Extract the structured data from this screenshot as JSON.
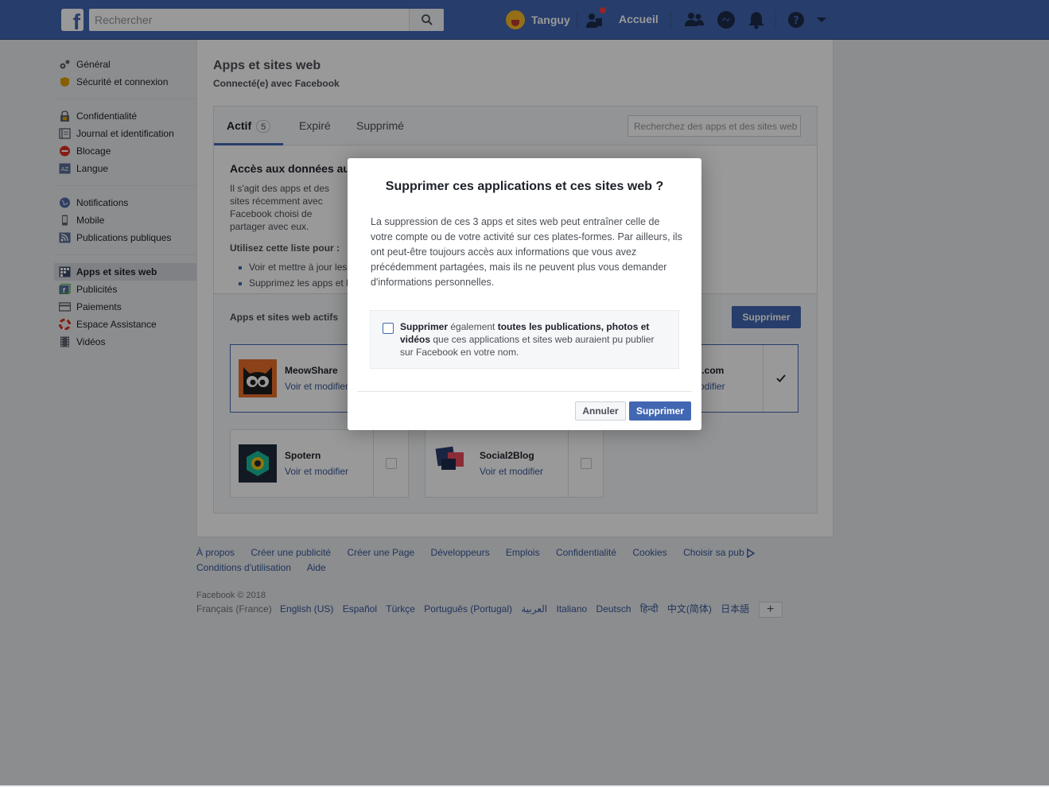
{
  "topbar": {
    "search_placeholder": "Rechercher",
    "user_name": "Tanguy",
    "home_label": "Accueil"
  },
  "sidebar": {
    "groups": [
      [
        {
          "label": "Général",
          "icon": "gears-icon"
        },
        {
          "label": "Sécurité et connexion",
          "icon": "badge-icon"
        }
      ],
      [
        {
          "label": "Confidentialité",
          "icon": "lock-icon"
        },
        {
          "label": "Journal et identification",
          "icon": "timeline-icon"
        },
        {
          "label": "Blocage",
          "icon": "block-icon"
        },
        {
          "label": "Langue",
          "icon": "language-icon"
        }
      ],
      [
        {
          "label": "Notifications",
          "icon": "globe-icon"
        },
        {
          "label": "Mobile",
          "icon": "phone-icon"
        },
        {
          "label": "Publications publiques",
          "icon": "rss-icon"
        }
      ],
      [
        {
          "label": "Apps et sites web",
          "icon": "apps-icon",
          "active": true
        },
        {
          "label": "Publicités",
          "icon": "ads-icon"
        },
        {
          "label": "Paiements",
          "icon": "card-icon"
        },
        {
          "label": "Espace Assistance",
          "icon": "lifebuoy-icon"
        },
        {
          "label": "Vidéos",
          "icon": "film-icon"
        }
      ]
    ]
  },
  "main": {
    "title": "Apps et sites web",
    "subtitle": "Connecté(e) avec Facebook",
    "tabs": [
      {
        "label": "Actif",
        "count": "5"
      },
      {
        "label": "Expiré"
      },
      {
        "label": "Supprimé"
      }
    ],
    "tab_search_placeholder": "Recherchez des apps et des sites web",
    "info": {
      "title": "Accès aux données au",
      "text": "Il s'agit des apps et des sites récemment avec Facebook choisi de partager avec eux.",
      "use_title": "Utilisez cette liste pour :",
      "bullets": [
        "Voir et mettre à jour les",
        "Supprimez les apps et l"
      ]
    },
    "active_heading": "Apps et sites web actifs",
    "delete_button": "Supprimer",
    "apps": [
      {
        "name": "MeowShare",
        "link": "Voir et modifier",
        "checked": false
      },
      {
        "name": "es.com",
        "link": "modifier",
        "checked": true
      },
      {
        "name": "Spotern",
        "link": "Voir et modifier",
        "checked": false
      },
      {
        "name": "Social2Blog",
        "link": "Voir et modifier",
        "checked": false
      }
    ]
  },
  "dialog": {
    "title": "Supprimer ces applications et ces sites web ?",
    "body": "La suppression de ces 3 apps et sites web peut entraîner celle de votre compte ou de votre activité sur ces plates-formes. Par ailleurs, ils ont peut-être toujours accès aux informations que vous avez précédemment partagées, mais ils ne peuvent plus vous demander d'informations personnelles.",
    "option_part1": "Supprimer",
    "option_part2": " également ",
    "option_part3": "toutes les publications, photos et vidéos",
    "option_part4": " que ces applications et sites web auraient pu publier sur Facebook en votre nom.",
    "cancel": "Annuler",
    "confirm": "Supprimer"
  },
  "footer": {
    "links": [
      "À propos",
      "Créer une publicité",
      "Créer une Page",
      "Développeurs",
      "Emplois",
      "Confidentialité",
      "Cookies",
      "Choisir sa pub",
      "Conditions d'utilisation",
      "Aide"
    ],
    "copyright": "Facebook © 2018",
    "current_lang": "Français (France)",
    "languages": [
      "English (US)",
      "Español",
      "Türkçe",
      "Português (Portugal)",
      "العربية",
      "Italiano",
      "Deutsch",
      "हिन्दी",
      "中文(简体)",
      "日本語"
    ],
    "plus": "+"
  },
  "colors": {
    "brand": "#4267b2",
    "link": "#365899",
    "background": "#e9ebee"
  }
}
